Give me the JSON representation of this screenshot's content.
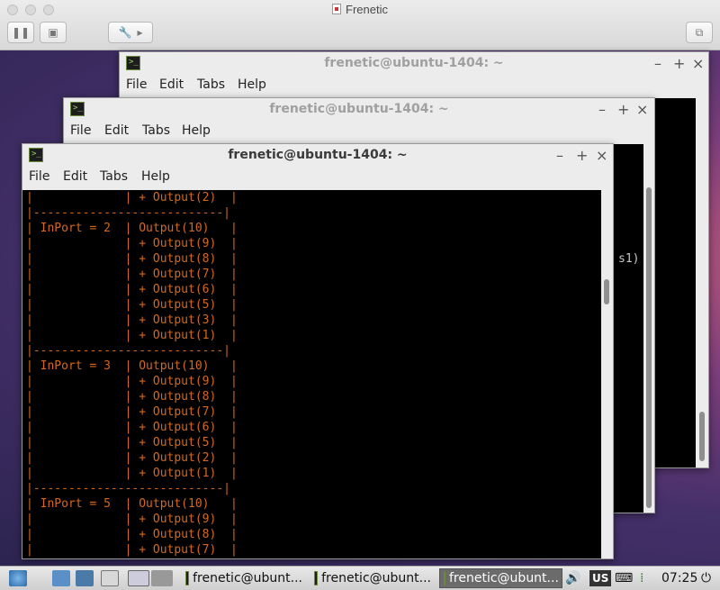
{
  "host": {
    "title": "Frenetic"
  },
  "terminals": {
    "back": {
      "title": "frenetic@ubuntu-1404: ~",
      "menu": [
        "File",
        "Edit",
        "Tabs",
        "Help"
      ],
      "visible_text": "s1)"
    },
    "mid": {
      "title": "frenetic@ubuntu-1404: ~",
      "menu": [
        "File",
        "Edit",
        "Tabs",
        "Help"
      ]
    },
    "front": {
      "title": "frenetic@ubuntu-1404: ~",
      "menu": [
        "File",
        "Edit",
        "Tabs",
        "Help"
      ],
      "output": "|             | + Output(2)  |\n|---------------------------|\n| InPort = 2  | Output(10)   |\n|             | + Output(9)  |\n|             | + Output(8)  |\n|             | + Output(7)  |\n|             | + Output(6)  |\n|             | + Output(5)  |\n|             | + Output(3)  |\n|             | + Output(1)  |\n|---------------------------|\n| InPort = 3  | Output(10)   |\n|             | + Output(9)  |\n|             | + Output(8)  |\n|             | + Output(7)  |\n|             | + Output(6)  |\n|             | + Output(5)  |\n|             | + Output(2)  |\n|             | + Output(1)  |\n|---------------------------|\n| InPort = 5  | Output(10)   |\n|             | + Output(9)  |\n|             | + Output(8)  |\n|             | + Output(7)  |"
    }
  },
  "window_controls": {
    "minimize": "–",
    "maximize": "+",
    "close": "×"
  },
  "taskbar": {
    "tasks": [
      "frenetic@ubunt...",
      "frenetic@ubunt...",
      "frenetic@ubunt..."
    ],
    "active_task": 2,
    "keyboard_layout": "US",
    "clock": "07:25"
  }
}
